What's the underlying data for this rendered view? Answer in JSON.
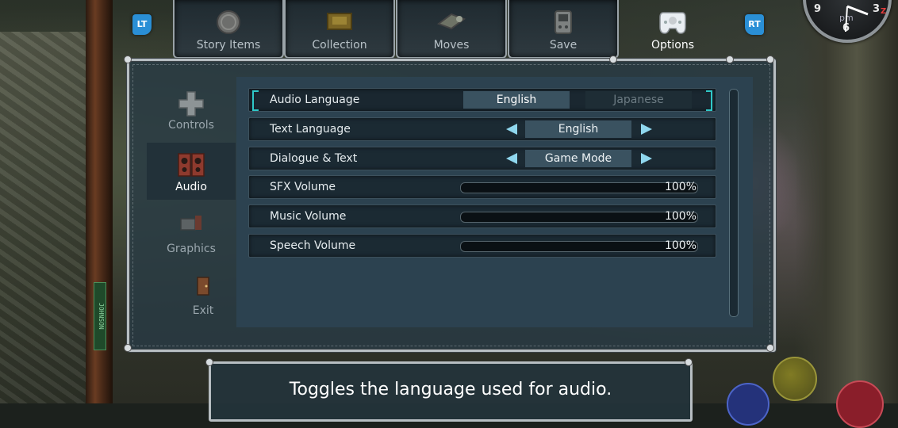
{
  "tabs": [
    {
      "label": "Story Items",
      "icon": "coin-icon"
    },
    {
      "label": "Collection",
      "icon": "collection-box-icon"
    },
    {
      "label": "Moves",
      "icon": "moves-scroll-icon"
    },
    {
      "label": "Save",
      "icon": "vmu-save-icon"
    },
    {
      "label": "Options",
      "icon": "controller-icon",
      "active": true
    }
  ],
  "shoulder": {
    "left": "LT",
    "right": "RT"
  },
  "sidebar": {
    "items": [
      {
        "label": "Controls",
        "icon": "dpad-icon"
      },
      {
        "label": "Audio",
        "icon": "speaker-icon",
        "active": true
      },
      {
        "label": "Graphics",
        "icon": "graphics-icon"
      },
      {
        "label": "Exit",
        "icon": "exit-door-icon"
      }
    ]
  },
  "settings": {
    "audio_language": {
      "label": "Audio Language",
      "options": [
        "English",
        "Japanese"
      ],
      "selected": "English"
    },
    "text_language": {
      "label": "Text Language",
      "value": "English"
    },
    "dialogue_text": {
      "label": "Dialogue & Text",
      "value": "Game Mode"
    },
    "sfx_volume": {
      "label": "SFX Volume",
      "value": "100%",
      "level": 1.0
    },
    "music_volume": {
      "label": "Music Volume",
      "value": "100%",
      "level": 1.0
    },
    "speech_volume": {
      "label": "Speech Volume",
      "value": "100%",
      "level": 1.0
    }
  },
  "help_text": "Toggles the language used for audio.",
  "clock": {
    "n9": "9",
    "n3": "3",
    "n6": "6",
    "pm": "pm",
    "z": "Z"
  },
  "pole_sign": "JOHNSON",
  "colors": {
    "accent_cyan": "#2fc8c8",
    "arrow": "#8fd7ee",
    "shoulder_blue": "#2a8fd6"
  }
}
